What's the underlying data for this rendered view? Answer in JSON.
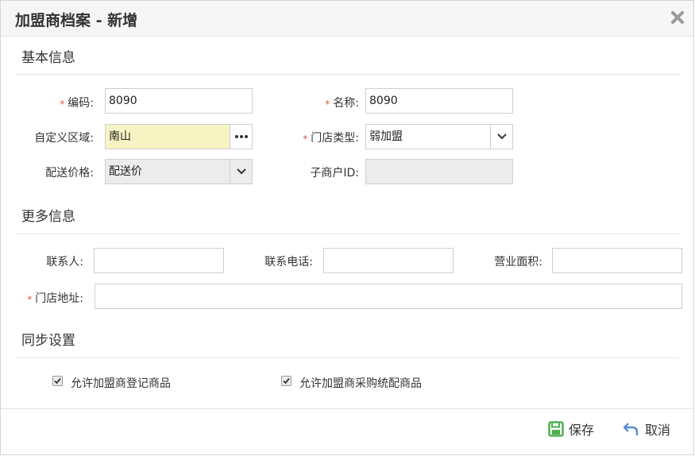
{
  "dialog": {
    "title": "加盟商档案 - 新增",
    "close_icon": "close-icon"
  },
  "sections": {
    "basic": "基本信息",
    "more": "更多信息",
    "sync": "同步设置"
  },
  "basic": {
    "code": {
      "label": "编码:",
      "value": "8090",
      "required": true
    },
    "name": {
      "label": "名称:",
      "value": "8090",
      "required": true
    },
    "region": {
      "label": "自定义区域:",
      "value": "南山",
      "icon": "ellipsis-icon"
    },
    "store_type": {
      "label": "门店类型:",
      "value": "弱加盟",
      "required": true,
      "icon": "chevron-down-icon"
    },
    "price": {
      "label": "配送价格:",
      "value": "配送价",
      "icon": "chevron-down-icon"
    },
    "sub_id": {
      "label": "子商户ID:",
      "value": ""
    }
  },
  "more": {
    "contact": {
      "label": "联系人:",
      "value": ""
    },
    "phone": {
      "label": "联系电话:",
      "value": ""
    },
    "area": {
      "label": "营业面积:",
      "value": ""
    },
    "address": {
      "label": "门店地址:",
      "value": "",
      "required": true
    }
  },
  "sync": {
    "opt1": {
      "label": "允许加盟商登记商品",
      "checked": true
    },
    "opt2": {
      "label": "允许加盟商采购统配商品",
      "checked": true
    }
  },
  "footer": {
    "save": "保存",
    "cancel": "取消"
  },
  "colors": {
    "required": "#d9534f",
    "highlight": "#f7f3c3",
    "save_icon": "#4caf50",
    "cancel_icon": "#5b8fd0"
  }
}
